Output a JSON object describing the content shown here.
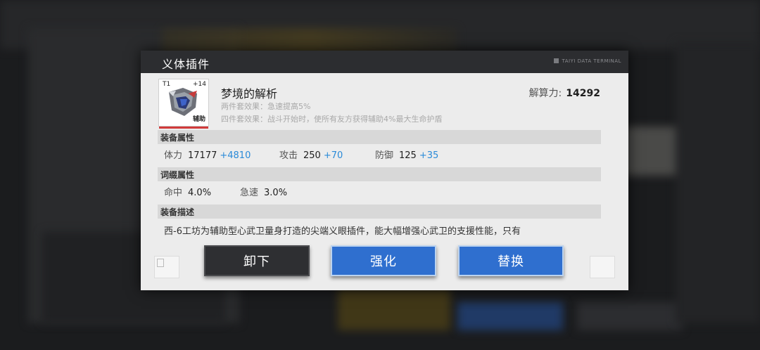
{
  "dialog": {
    "title": "义体插件",
    "terminal_label": "TAIYI DATA TERMINAL"
  },
  "item": {
    "tier": "T1",
    "level": "+14",
    "role": "辅助",
    "name": "梦境的解析",
    "set2_effect": "两件套效果：急速提高5%",
    "set4_effect": "四件套效果：战斗开始时，使所有友方获得辅助4%最大生命护盾",
    "power_label": "解算力:",
    "power_value": "14292"
  },
  "equipment_stats": {
    "header": "装备属性",
    "stats": [
      {
        "label": "体力",
        "value": "17177",
        "bonus": "+4810"
      },
      {
        "label": "攻击",
        "value": "250",
        "bonus": "+70"
      },
      {
        "label": "防御",
        "value": "125",
        "bonus": "+35"
      }
    ]
  },
  "affix_stats": {
    "header": "词缀属性",
    "stats": [
      {
        "label": "命中",
        "value": "4.0%"
      },
      {
        "label": "急速",
        "value": "3.0%"
      }
    ]
  },
  "description": {
    "header": "装备描述",
    "text": "西-6工坊为辅助型心武卫量身打造的尖端义眼插件，能大幅增强心武卫的支援性能，只有"
  },
  "buttons": {
    "unequip": "卸下",
    "enhance": "强化",
    "replace": "替换"
  },
  "colors": {
    "bonus": "#2a8ad8",
    "primary_button": "#2f6fcf",
    "dark_button": "#2e2f32",
    "header_bar": "#2c2d30"
  }
}
